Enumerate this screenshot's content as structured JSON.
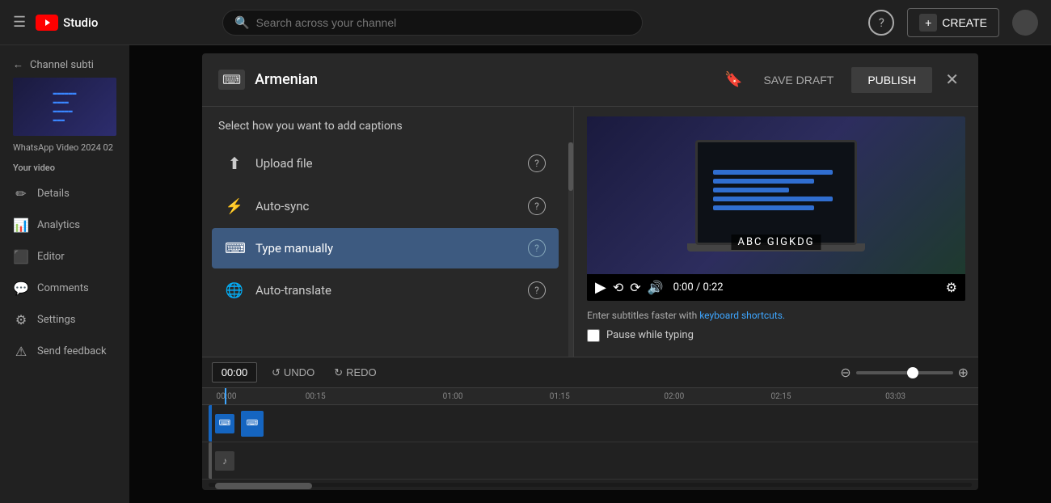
{
  "topbar": {
    "menu_label": "☰",
    "studio_label": "Studio",
    "search_placeholder": "Search across your channel",
    "help_icon": "?",
    "create_label": "CREATE",
    "create_icon": "+"
  },
  "sidebar": {
    "back_label": "Channel subti",
    "video_name": "WhatsApp Video 2024 02",
    "your_video_label": "Your video",
    "items": [
      {
        "id": "details",
        "icon": "✏",
        "label": "Details"
      },
      {
        "id": "analytics",
        "icon": "📊",
        "label": "Analytics"
      },
      {
        "id": "editor",
        "icon": "🎬",
        "label": "Editor"
      },
      {
        "id": "comments",
        "icon": "💬",
        "label": "Comments"
      },
      {
        "id": "settings",
        "icon": "⚙",
        "label": "Settings"
      },
      {
        "id": "feedback",
        "icon": "⚠",
        "label": "Send feedback"
      }
    ]
  },
  "modal": {
    "title": "Armenian",
    "save_draft_label": "SAVE DRAFT",
    "publish_label": "PUBLISH",
    "left_panel_header": "Select how you want to add captions",
    "options": [
      {
        "id": "upload",
        "icon": "↑",
        "label": "Upload file"
      },
      {
        "id": "autosync",
        "icon": "⚡",
        "label": "Auto-sync"
      },
      {
        "id": "manually",
        "icon": "⌨",
        "label": "Type manually",
        "selected": true
      },
      {
        "id": "autotranslate",
        "icon": "🌐",
        "label": "Auto-translate"
      }
    ],
    "video": {
      "caption_text": "ABC GIGKDG",
      "time_current": "0:00",
      "time_total": "0:22"
    },
    "subtitle_hint": "Enter subtitles faster with ",
    "keyboard_shortcuts_link": "keyboard shortcuts.",
    "pause_while_typing_label": "Pause while typing"
  },
  "timeline": {
    "time_value": "00:00",
    "undo_label": "UNDO",
    "redo_label": "REDO",
    "markers": [
      "00:00",
      "00:15",
      "01:00",
      "01:15",
      "02:00",
      "02:15",
      "03:03"
    ],
    "zoom_value": 60
  }
}
